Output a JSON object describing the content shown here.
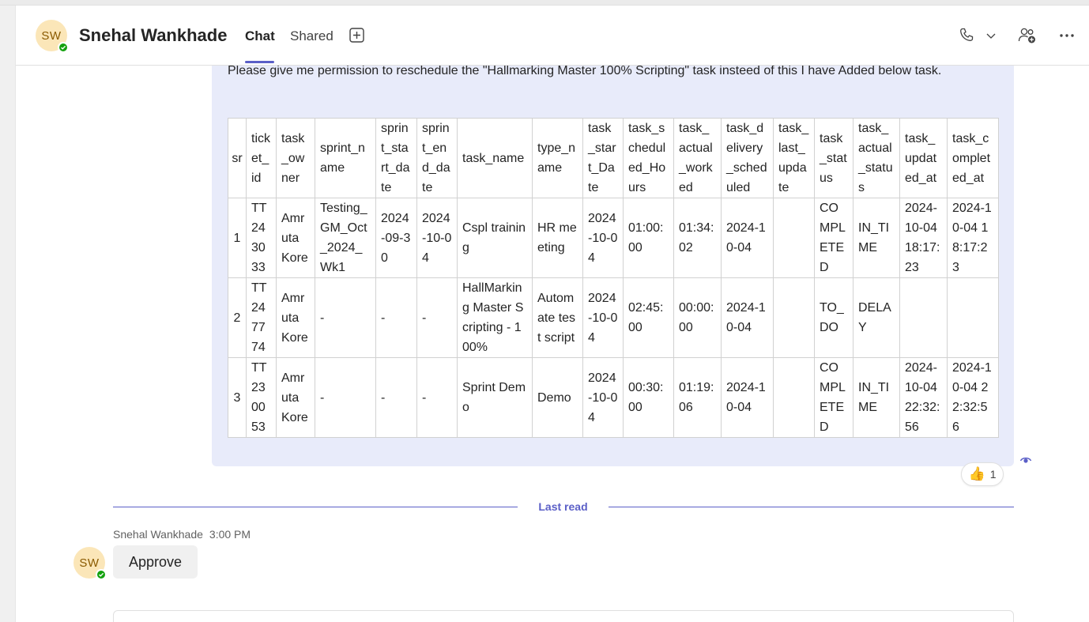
{
  "header": {
    "avatar_initials": "SW",
    "title": "Snehal Wankhade",
    "tabs": [
      {
        "label": "Chat",
        "active": true
      },
      {
        "label": "Shared",
        "active": false
      }
    ],
    "add_tab_icon": "plus-square-icon",
    "call_icon": "phone-icon",
    "call_dropdown_icon": "chevron-down-icon",
    "people_icon": "people-add-icon",
    "more_icon": "more-horizontal-icon"
  },
  "message": {
    "text": "Please give me permission to reschedule the \"Hallmarking Master 100% Scripting\" task  insteed of this I have Added below task.",
    "table": {
      "columns": [
        "sr",
        "ticket_id",
        "task_owner",
        "sprint_name",
        "sprint_start_date",
        "sprint_end_date",
        "task_name",
        "type_name",
        "task_start_Date",
        "task_scheduled_Hours",
        "task_actual_worked",
        "task_delivery_scheduled",
        "task_last_update",
        "task_status",
        "task_actual_status",
        "task_updated_at",
        "task_completed_at"
      ],
      "rows": [
        [
          "1",
          "TT243033",
          "Amruta Kore",
          "Testing_GM_Oct_2024_Wk1",
          "2024-09-30",
          "2024-10-04",
          "Cspl training",
          "HR meeting",
          "2024-10-04",
          "01:00:00",
          "01:34:02",
          "2024-10-04",
          "",
          "COMPLETED",
          "IN_TIME",
          "2024-10-04 18:17:23",
          "2024-10-04 18:17:23"
        ],
        [
          "2",
          "TT247774",
          "Amruta Kore",
          "-",
          "-",
          "-",
          "HallMarking Master Scripting - 100%",
          "Automate test script",
          "2024-10-04",
          "02:45:00",
          "00:00:00",
          "2024-10-04",
          "",
          "TO_DO",
          "DELAY",
          "",
          ""
        ],
        [
          "3",
          "TT230053",
          "Amruta Kore",
          "-",
          "-",
          "-",
          "Sprint Demo",
          "Demo",
          "2024-10-04",
          "00:30:00",
          "01:19:06",
          "2024-10-04",
          "",
          "COMPLETED",
          "IN_TIME",
          "2024-10-04 22:32:56",
          "2024-10-04 22:32:56"
        ]
      ]
    },
    "seen_icon": "eye-seen-icon",
    "reaction": {
      "emoji": "👍",
      "count": "1"
    }
  },
  "last_read": {
    "label": "Last read"
  },
  "reply": {
    "sender": "Snehal Wankhade",
    "time": "3:00 PM",
    "avatar_initials": "SW",
    "text": "Approve"
  },
  "colors": {
    "accent": "#5b5fc7",
    "bubble": "#e8ebfa",
    "presence": "#13a10e",
    "avatar_bg": "#fbe6b8"
  }
}
